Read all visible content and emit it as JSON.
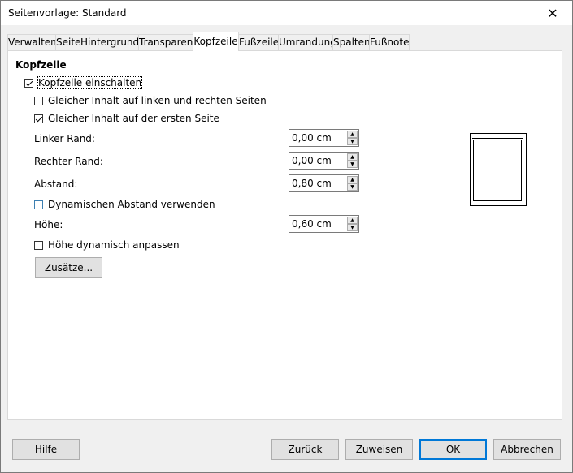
{
  "window": {
    "title": "Seitenvorlage: Standard"
  },
  "tabs": [
    {
      "label": "Verwalten"
    },
    {
      "label": "Seite"
    },
    {
      "label": "Hintergrund"
    },
    {
      "label": "Transparenz"
    },
    {
      "label": "Kopfzeile"
    },
    {
      "label": "Fußzeile"
    },
    {
      "label": "Umrandung"
    },
    {
      "label": "Spalten"
    },
    {
      "label": "Fußnote"
    }
  ],
  "active_tab": "Kopfzeile",
  "section": {
    "title": "Kopfzeile"
  },
  "options": {
    "header_on": {
      "label": "Kopfzeile einschalten",
      "checked": true
    },
    "same_left_right": {
      "label": "Gleicher Inhalt auf linken und rechten Seiten",
      "checked": false
    },
    "same_first": {
      "label": "Gleicher Inhalt auf der ersten Seite",
      "checked": true
    },
    "dynamic_spacing": {
      "label": "Dynamischen Abstand verwenden",
      "checked": false
    },
    "autofit_height": {
      "label": "Höhe dynamisch anpassen",
      "checked": false
    }
  },
  "fields": {
    "left_margin": {
      "label": "Linker Rand:",
      "value": "0,00 cm"
    },
    "right_margin": {
      "label": "Rechter Rand:",
      "value": "0,00 cm"
    },
    "spacing": {
      "label": "Abstand:",
      "value": "0,80 cm"
    },
    "height": {
      "label": "Höhe:",
      "value": "0,60 cm"
    }
  },
  "more_button": {
    "label": "Zusätze..."
  },
  "footer_buttons": {
    "help": "Hilfe",
    "reset": "Zurück",
    "assign": "Zuweisen",
    "ok": "OK",
    "cancel": "Abbrechen"
  }
}
